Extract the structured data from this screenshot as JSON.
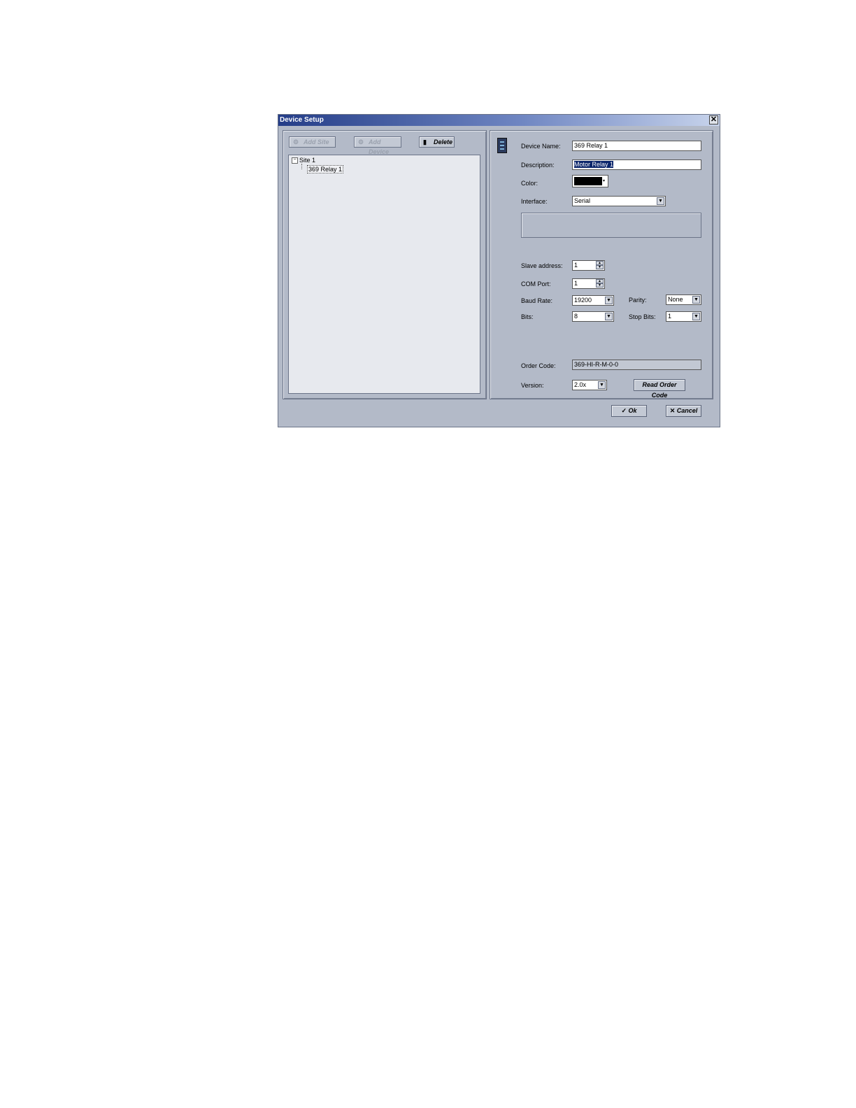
{
  "window": {
    "title": "Device Setup",
    "close_glyph": "✕"
  },
  "toolbar": {
    "add_site": "Add Site",
    "add_device": "Add Device",
    "delete": "Delete"
  },
  "tree": {
    "site": "Site 1",
    "device": "369 Relay 1",
    "expander": "−"
  },
  "form": {
    "device_name_label": "Device Name:",
    "device_name": "369 Relay 1",
    "description_label": "Description:",
    "description": "Motor Relay 1",
    "color_label": "Color:",
    "color_value": "#000000",
    "interface_label": "Interface:",
    "interface": "Serial",
    "slave_address_label": "Slave address:",
    "slave_address": "1",
    "com_port_label": "COM Port:",
    "com_port": "1",
    "baud_rate_label": "Baud Rate:",
    "baud_rate": "19200",
    "parity_label": "Parity:",
    "parity": "None",
    "bits_label": "Bits:",
    "bits": "8",
    "stop_bits_label": "Stop Bits:",
    "stop_bits": "1",
    "order_code_label": "Order Code:",
    "order_code": "369-HI-R-M-0-0",
    "version_label": "Version:",
    "version": "2.0x",
    "read_order_code": "Read Order Code"
  },
  "footer": {
    "ok": "Ok",
    "cancel": "Cancel"
  },
  "icons": {
    "add_site": "site-icon",
    "add_device": "device-add-icon",
    "delete": "trash-icon",
    "ok": "checkmark-icon",
    "cancel": "x-icon"
  }
}
